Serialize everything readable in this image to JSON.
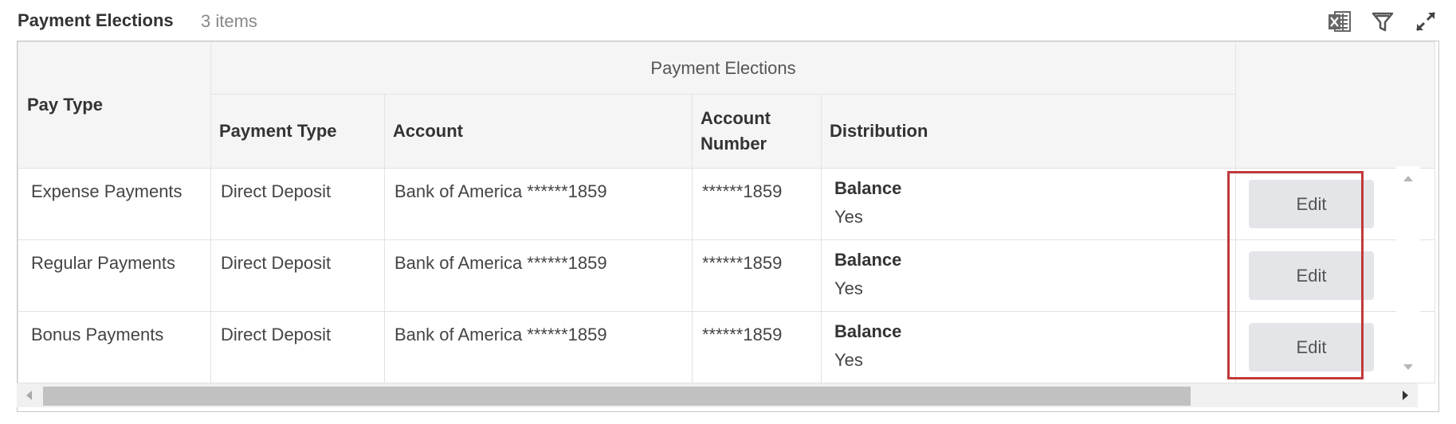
{
  "header": {
    "title": "Payment Elections",
    "count": "3 items"
  },
  "toolbar": {
    "icons": [
      "excel-export-icon",
      "filter-icon",
      "expand-icon"
    ]
  },
  "table": {
    "group_header": "Payment Elections",
    "columns": {
      "pay_type": "Pay Type",
      "payment_type": "Payment Type",
      "account": "Account",
      "account_number_line1": "Account",
      "account_number_line2": "Number",
      "distribution": "Distribution"
    },
    "rows": [
      {
        "pay_type": "Expense Payments",
        "payment_type": "Direct Deposit",
        "account": "Bank of America ******1859",
        "account_number": "******1859",
        "distribution_label": "Balance",
        "distribution_value": "Yes",
        "action": "Edit"
      },
      {
        "pay_type": "Regular Payments",
        "payment_type": "Direct Deposit",
        "account": "Bank of America ******1859",
        "account_number": "******1859",
        "distribution_label": "Balance",
        "distribution_value": "Yes",
        "action": "Edit"
      },
      {
        "pay_type": "Bonus Payments",
        "payment_type": "Direct Deposit",
        "account": "Bank of America ******1859",
        "account_number": "******1859",
        "distribution_label": "Balance",
        "distribution_value": "Yes",
        "action": "Edit"
      }
    ]
  },
  "colors": {
    "highlight": "#c0393b",
    "header_bg": "#f5f5f5",
    "button_bg": "#e3e5e8"
  }
}
